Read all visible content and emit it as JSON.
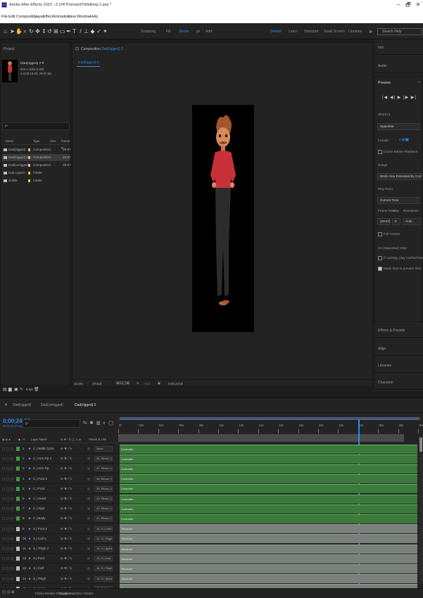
{
  "window": {
    "title": "Adobe After Effects 2023 - Z:\\24\\Thomas\\D\\Walking-1.aep *",
    "icon_label": "Ae",
    "controls": [
      "–",
      "🗗",
      "✕"
    ]
  },
  "menu": [
    "File",
    "Edit",
    "Composition",
    "Layer",
    "Effect",
    "Animation",
    "View",
    "Window",
    "Help"
  ],
  "toolbar": {
    "snapping": "Snapping",
    "fill": "Fill",
    "stroke": "Stroke",
    "stroke_width": "2",
    "px": "px",
    "add": "Add:",
    "workspaces": [
      "Default",
      "Learn",
      "Standard",
      "Small Screen",
      "Libraries"
    ],
    "search_placeholder": "Search Help",
    "fill_color": "#ee1111"
  },
  "project": {
    "title": "Project",
    "selected_name": "Dad(rigged) 2 ▾",
    "selected_info1": "842 x 1186 (1.00)",
    "selected_info2": "Δ 0;00;19;20, 29.97 fps",
    "search_placeholder": "ρ-",
    "columns": [
      "Name",
      "Type",
      "Size",
      "Frame R..."
    ],
    "items": [
      {
        "name": "Dad(rigged)",
        "type": "Composition",
        "fps": "29.97",
        "tag": "#d2c27e"
      },
      {
        "name": "Dad(rigged) 2",
        "type": "Composition",
        "fps": "29.97",
        "tag": "#d2c27e"
      },
      {
        "name": "Dad(unrigged)",
        "type": "Composition",
        "fps": "29.97",
        "tag": "#d2c27e"
      },
      {
        "name": "Dad Layers",
        "type": "Folder",
        "fps": "",
        "tag": "#e2cc2a"
      },
      {
        "name": "Solids",
        "type": "Folder",
        "fps": "",
        "tag": "#e2cc2a"
      }
    ],
    "bpc": "8 bpc"
  },
  "composition": {
    "tab_label": "Composition",
    "tab_name": "Dad(rigged) 2",
    "breadcrumb": "Dad(rigged) 2",
    "zoom": "33.3%",
    "resolution": "(Third)",
    "exposure": "+0.0",
    "timecode": "0;00;24;03"
  },
  "right_panels": {
    "top_heads": [
      "Info",
      "Audio"
    ],
    "preview": {
      "title": "Preview",
      "controls": [
        "|◀",
        "◀|",
        "▶",
        "|▶",
        "▶|"
      ],
      "shortcut_label": "Shortcut",
      "shortcut_value": "Spacebar",
      "include_label": "Include:",
      "cache_label": "Cache Before Playback",
      "range_label": "Range",
      "range_value": "Work Area Extended By Current...",
      "play_from_label": "Play From",
      "play_from_value": "Current Time",
      "fr_label": "Frame Rate",
      "skip_label": "Skip",
      "res_label": "Resolution",
      "fr_value": "(29.97)",
      "skip_value": "0",
      "res_value": "Auto",
      "full_screen": "Full Screen",
      "on_stop_label": "On (Spacebar) Stop:",
      "if_caching": "If caching, play cached frames",
      "move_time": "Move time to preview time"
    },
    "bottom_heads": [
      "Effects & Presets",
      "Align",
      "Libraries",
      "Character"
    ]
  },
  "timeline": {
    "tabs": [
      "Dad(rigged)",
      "Dad(unrigged)",
      "Dad(rigged) 2"
    ],
    "timecode": "0;00;24;03",
    "timecode_sub": "00723 (29.97 fps)",
    "search_placeholder": "ρ-",
    "columns": {
      "layer_name": "Layer Name",
      "parent": "Parent & Link"
    },
    "ruler": [
      "0f",
      "02s",
      "04s",
      "06s",
      "08s",
      "10s",
      "12s",
      "14s",
      "16s",
      "18s",
      "20s",
      "22s",
      "24s",
      "26s",
      "28s",
      "30s"
    ],
    "layers": [
      {
        "n": "1",
        "name": "C | Walk Cycle",
        "parent": "None",
        "bar": "Controller",
        "label": "#3a9e3a"
      },
      {
        "n": "2",
        "name": "C | Arm Rp 2",
        "parent": "36. Elbow | C",
        "bar": "Controller",
        "label": "#3a9e3a"
      },
      {
        "n": "3",
        "name": "C | Arm Rp",
        "parent": "37. Elbow | C",
        "bar": "Controller",
        "label": "#3a9e3a"
      },
      {
        "n": "4",
        "name": "C | Foot 2",
        "parent": "38. Elbow | C",
        "bar": "Controller",
        "label": "#3a9e3a"
      },
      {
        "n": "5",
        "name": "C | Foot",
        "parent": "39. Elbow | C",
        "bar": "Controller",
        "label": "#3a9e3a"
      },
      {
        "n": "6",
        "name": "C | Head",
        "parent": "40. Elbow | C",
        "bar": "Controller",
        "label": "#3a9e3a"
      },
      {
        "n": "7",
        "name": "C | Hips",
        "parent": "41. Elbow | C",
        "bar": "Controller",
        "label": "#3a9e3a"
      },
      {
        "n": "8",
        "name": "C | Body",
        "parent": "42. Elbow | C",
        "bar": "Controller",
        "label": "#3a9e3a"
      },
      {
        "n": "9",
        "name": "S | Foot 2",
        "parent": "10. S | Calf 2",
        "bar": "Structure",
        "label": "#bdbdbd"
      },
      {
        "n": "10",
        "name": "S | Calf 2",
        "parent": "11. S | Thigh",
        "bar": "Structure",
        "label": "#bdbdbd"
      },
      {
        "n": "11",
        "name": "S | Thigh 2",
        "parent": "15. S | Spine",
        "bar": "Structure",
        "label": "#bdbdbd"
      },
      {
        "n": "12",
        "name": "S | Foot",
        "parent": "13. S | Calf",
        "bar": "Structure",
        "label": "#bdbdbd"
      },
      {
        "n": "13",
        "name": "S | Calf",
        "parent": "14. S | Thigh",
        "bar": "Structure",
        "label": "#bdbdbd"
      },
      {
        "n": "14",
        "name": "S | Thigh",
        "parent": "15. S | Spine",
        "bar": "Structure",
        "label": "#bdbdbd"
      },
      {
        "n": "15",
        "name": "S | Spine",
        "parent": "16. S | Spine",
        "bar": "Structure",
        "label": "#bdbdbd"
      }
    ],
    "status": "Toggle Switches / Modes",
    "frame_render": "Frame Render Time: 0ms"
  }
}
